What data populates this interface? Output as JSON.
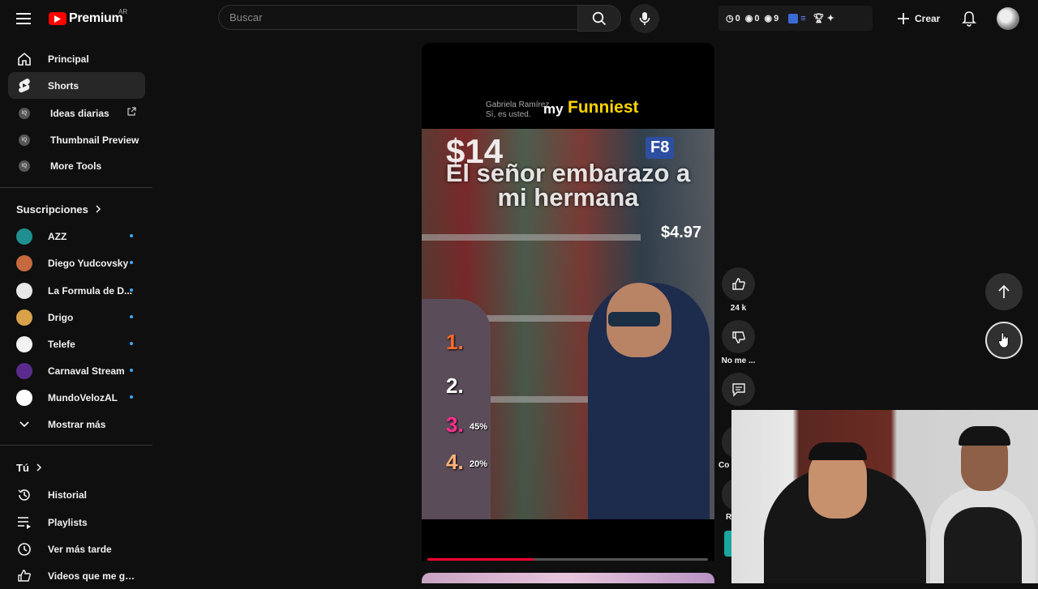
{
  "header": {
    "logo_text": "Premium",
    "logo_region": "AR",
    "search_placeholder": "Buscar",
    "create_label": "Crear",
    "ext_stats": [
      "0",
      "0",
      "9"
    ]
  },
  "sidebar": {
    "main": [
      {
        "label": "Principal",
        "icon": "home-icon"
      },
      {
        "label": "Shorts",
        "icon": "shorts-icon"
      }
    ],
    "tools": [
      {
        "label": "Ideas diarias",
        "icon": "tool-icon"
      },
      {
        "label": "Thumbnail Preview",
        "icon": "tool-icon"
      },
      {
        "label": "More Tools",
        "icon": "tool-icon"
      }
    ],
    "subscriptions_title": "Suscripciones",
    "subscriptions": [
      {
        "label": "AZZ",
        "color": "#1f8f8f"
      },
      {
        "label": "Diego Yudcovsky",
        "color": "#c46a3e"
      },
      {
        "label": "La Formula de D...",
        "color": "#e8e8e8"
      },
      {
        "label": "Drigo",
        "color": "#d8a24a"
      },
      {
        "label": "Telefe",
        "color": "#f2f2f2"
      },
      {
        "label": "Carnaval Stream",
        "color": "#5a2b8c"
      },
      {
        "label": "MundoVelozAL",
        "color": "#ffffff"
      }
    ],
    "show_more": "Mostrar más",
    "you_title": "Tú",
    "you_items": [
      {
        "label": "Historial",
        "icon": "history-icon"
      },
      {
        "label": "Playlists",
        "icon": "playlists-icon"
      },
      {
        "label": "Ver más tarde",
        "icon": "watch-later-icon"
      },
      {
        "label": "Videos que me gus...",
        "icon": "liked-videos-icon"
      }
    ]
  },
  "short": {
    "comment_name": "Gabriela Ramírez",
    "comment_text": "Sí, es usted.",
    "header_pre": "my",
    "header_highlight": "Funniest",
    "overlay_line1": "El señor embarazo a",
    "overlay_line2": "mi hermana",
    "price_left": "$14",
    "price_right": "$4.97",
    "aisle": "F8",
    "ranks": [
      {
        "n": "1.",
        "pct": "",
        "color": "#ff6a2a"
      },
      {
        "n": "2.",
        "pct": "",
        "color": "#ffffff"
      },
      {
        "n": "3.",
        "pct": "45%",
        "color": "#ff2f92"
      },
      {
        "n": "4.",
        "pct": "20%",
        "color": "#ffb37a"
      }
    ],
    "progress": 0.38
  },
  "actions": {
    "like_count": "24 k",
    "dislike_label": "No me ...",
    "comments_partial": "Co",
    "remix_partial": "R"
  }
}
